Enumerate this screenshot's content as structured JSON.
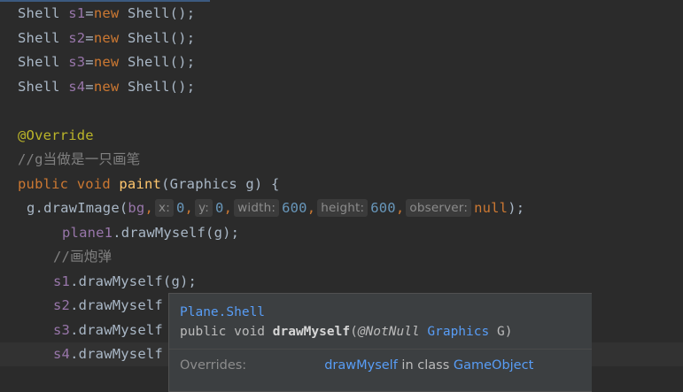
{
  "editor": {
    "lines": [
      {
        "id": "l1",
        "segments": [
          {
            "t": "Shell ",
            "c": ""
          },
          {
            "t": "s1",
            "c": "var"
          },
          {
            "t": "=",
            "c": ""
          },
          {
            "t": "new ",
            "c": "kw"
          },
          {
            "t": "Shell();",
            "c": ""
          }
        ]
      },
      {
        "id": "l2",
        "segments": [
          {
            "t": "Shell ",
            "c": ""
          },
          {
            "t": "s2",
            "c": "var"
          },
          {
            "t": "=",
            "c": ""
          },
          {
            "t": "new ",
            "c": "kw"
          },
          {
            "t": "Shell();",
            "c": ""
          }
        ]
      },
      {
        "id": "l3",
        "segments": [
          {
            "t": "Shell ",
            "c": ""
          },
          {
            "t": "s3",
            "c": "var"
          },
          {
            "t": "=",
            "c": ""
          },
          {
            "t": "new ",
            "c": "kw"
          },
          {
            "t": "Shell();",
            "c": ""
          }
        ]
      },
      {
        "id": "l4",
        "segments": [
          {
            "t": "Shell ",
            "c": ""
          },
          {
            "t": "s4",
            "c": "var"
          },
          {
            "t": "=",
            "c": ""
          },
          {
            "t": "new ",
            "c": "kw"
          },
          {
            "t": "Shell();",
            "c": ""
          }
        ]
      },
      {
        "id": "l6",
        "segments": [
          {
            "t": "@Override",
            "c": "ann"
          }
        ]
      },
      {
        "id": "l7",
        "segments": [
          {
            "t": "//g当做是一只画笔",
            "c": "cmt"
          }
        ]
      },
      {
        "id": "l8",
        "segments": [
          {
            "t": "public void ",
            "c": "kw"
          },
          {
            "t": "paint",
            "c": "fn"
          },
          {
            "t": "(Graphics g) {",
            "c": ""
          }
        ]
      },
      {
        "id": "l9",
        "segments": [
          {
            "t": "g.drawImage(",
            "c": ""
          },
          {
            "t": "bg",
            "c": "var"
          },
          {
            "t": ",",
            "c": "kw"
          },
          {
            "t": "x:",
            "c": "hint"
          },
          {
            "t": "0",
            "c": "num"
          },
          {
            "t": ",",
            "c": "kw"
          },
          {
            "t": "y:",
            "c": "hint"
          },
          {
            "t": "0",
            "c": "num"
          },
          {
            "t": ",",
            "c": "kw"
          },
          {
            "t": "width:",
            "c": "hint"
          },
          {
            "t": "600",
            "c": "num"
          },
          {
            "t": ",",
            "c": "kw"
          },
          {
            "t": "height:",
            "c": "hint"
          },
          {
            "t": "600",
            "c": "num"
          },
          {
            "t": ",",
            "c": "kw"
          },
          {
            "t": "observer:",
            "c": "hint"
          },
          {
            "t": "null",
            "c": "kw"
          },
          {
            "t": ");",
            "c": ""
          }
        ]
      },
      {
        "id": "l10",
        "segments": [
          {
            "t": "plane1",
            "c": "var"
          },
          {
            "t": ".drawMyself(g);",
            "c": ""
          }
        ]
      },
      {
        "id": "l11",
        "segments": [
          {
            "t": "//画炮弹",
            "c": "cmt"
          }
        ]
      },
      {
        "id": "l12",
        "segments": [
          {
            "t": "s1",
            "c": "var"
          },
          {
            "t": ".drawMyself(g);",
            "c": ""
          }
        ]
      },
      {
        "id": "l13",
        "segments": [
          {
            "t": "s2",
            "c": "var"
          },
          {
            "t": ".drawMyself",
            "c": ""
          }
        ]
      },
      {
        "id": "l14",
        "segments": [
          {
            "t": "s3",
            "c": "var"
          },
          {
            "t": ".drawMyself",
            "c": ""
          }
        ]
      },
      {
        "id": "l15",
        "segments": [
          {
            "t": "s4",
            "c": "var"
          },
          {
            "t": ".drawMyself",
            "c": ""
          }
        ]
      }
    ]
  },
  "popup": {
    "title": "Plane.Shell",
    "sig_prefix": "public void ",
    "sig_method": "drawMyself",
    "sig_open": "(",
    "sig_annotation": "@NotNull",
    "sig_type": "Graphics",
    "sig_param": " G)",
    "overrides_label": "Overrides:",
    "overrides_method": "drawMyself",
    "overrides_in_class": " in class ",
    "overrides_class": "GameObject"
  },
  "colors": {
    "background": "#2b2b2b",
    "keyword": "#cc7832",
    "field": "#9876aa",
    "method_decl": "#ffc66d",
    "number": "#6897bb",
    "annotation": "#bbb529",
    "comment": "#808080",
    "link": "#589df6"
  }
}
